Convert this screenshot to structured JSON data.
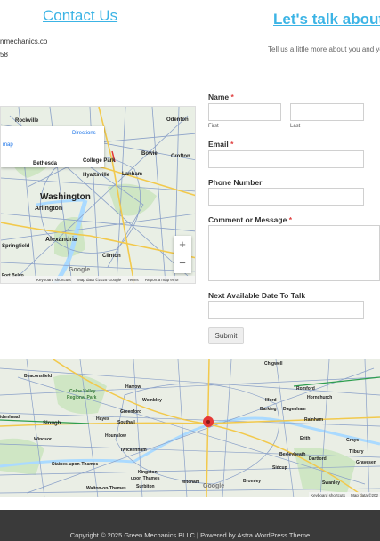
{
  "contact": {
    "heading": "Contact Us",
    "email_fragment": "nmechanics.co",
    "phone_fragment": "58"
  },
  "talk": {
    "heading": "Let's talk about y",
    "subtitle": "Tell us a little more about you and yo"
  },
  "top_map": {
    "directions": "Directions",
    "view_larger": "map",
    "zoom_in": "+",
    "zoom_out": "−",
    "cities": {
      "washington": "Washington",
      "arlington": "Arlington",
      "alexandria": "Alexandria",
      "bethesda": "Bethesda",
      "rockville": "Rockville",
      "college_park": "College Park",
      "hyattsville": "Hyattsville",
      "lanham": "Lanham",
      "bowie": "Bowie",
      "crofton": "Crofton",
      "odenton": "Odenton",
      "springfield": "Springfield",
      "clinton": "Clinton",
      "fort_belvoir": "Fort Belvo"
    },
    "google": "Google",
    "footer": {
      "shortcuts": "Keyboard shortcuts",
      "map_data": "Map data ©2025 Google",
      "terms": "Terms",
      "report": "Report a map error"
    }
  },
  "form": {
    "name_label": "Name",
    "required_mark": "*",
    "first_label": "First",
    "last_label": "Last",
    "email_label": "Email",
    "phone_label": "Phone Number",
    "comment_label": "Comment or Message",
    "date_label": "Next Available Date To Talk",
    "submit_label": "Submit"
  },
  "bottom_map": {
    "cities": {
      "chigwell": "Chigwell",
      "beaconsfield": "Beaconsfield",
      "colne_valley": "Colne Valley",
      "regional_park": "Regional Park",
      "harrow": "Harrow",
      "wembley": "Wembley",
      "romford": "Romford",
      "hornchurch": "Hornchurch",
      "ilford": "Ilford",
      "barking": "Barking",
      "dagenham": "Dagenham",
      "slough": "Slough",
      "hayes": "Hayes",
      "greenford": "Greenford",
      "southall": "Southall",
      "rainham": "Rainham",
      "maidenhead": "idenhead",
      "hounslow": "Hounslow",
      "erith": "Erith",
      "windsor": "Windsor",
      "twickenham": "Twickenham",
      "bexleyheath": "Bexleyheath",
      "dartford": "Dartford",
      "grays": "Grays",
      "tilbury": "Tilbury",
      "gravesend": "Gravesen",
      "staines": "Staines-upon-Thames",
      "kingston": "Kingston",
      "kingston2": "upon Thames",
      "sidcup": "Sidcup",
      "surbiton": "Surbiton",
      "mitcham": "Mitcham",
      "bromley": "Bromley",
      "walton": "Walton-on-Thames",
      "swanley": "Swanley"
    },
    "google": "Google",
    "footer": {
      "shortcuts": "Keyboard shortcuts",
      "map_data": "Map data ©202"
    }
  },
  "footer": {
    "copyright": "Copyright © 2025 Green Mechanics BLLC | Powered by ",
    "theme_link": "Astra WordPress Theme"
  },
  "colors": {
    "heading": "#3cb4e5",
    "required": "#e04040",
    "footer_bg": "#3a3a3a",
    "map_land": "#e9efe5",
    "map_road": "#8aa0c8",
    "map_highway": "#f2c94c",
    "map_park": "#cfe6c4",
    "map_water": "#aadaff",
    "pin": "#e53935"
  }
}
